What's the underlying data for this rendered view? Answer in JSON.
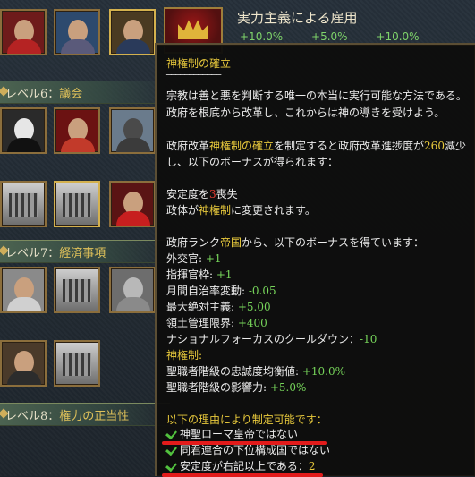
{
  "header": {
    "title": "実力主義による雇用",
    "stats": [
      "+10.0%",
      "+5.0%",
      "+10.0%"
    ]
  },
  "levels": [
    {
      "label_prefix": "レベル6：",
      "label_name": "議会"
    },
    {
      "label_prefix": "レベル7：",
      "label_name": "経済事項"
    },
    {
      "label_prefix": "レベル8：",
      "label_name": "権力の正当性"
    }
  ],
  "tooltip": {
    "title": "神権制の確立",
    "separator": "────────────",
    "desc1": "宗教は善と悪を判断する唯一の本当に実行可能な方法である。",
    "desc2": "政府を根底から改革し、これからは神の導きを受けよう。",
    "enact_a": "政府改革",
    "enact_name": "神権制の確立",
    "enact_b": "を制定すると政府改革進捗度が",
    "enact_cost": "260",
    "enact_c": "減少",
    "enact_line2": "し、以下のボーナスが得られます：",
    "stab_a": "安定度を",
    "stab_val": "3",
    "stab_b": "喪失",
    "gov_a": "政体が",
    "gov_name": "神権制",
    "gov_b": "に変更されます。",
    "rank_a": "政府ランク",
    "rank_name": "帝国",
    "rank_b": "から、以下のボーナスを得ています：",
    "bonuses": [
      {
        "label": "外交官: ",
        "value": "+1"
      },
      {
        "label": "指揮官枠: ",
        "value": "+1"
      },
      {
        "label": "月間自治率変動: ",
        "value": "-0.05"
      },
      {
        "label": "最大絶対主義: ",
        "value": "+5.00"
      },
      {
        "label": "領土管理限界: ",
        "value": "+400"
      },
      {
        "label": "ナショナルフォーカスのクールダウン：",
        "value": "-10"
      }
    ],
    "theocracy_header": "神権制:",
    "theocracy_bonuses": [
      {
        "label": "聖職者階級の忠誠度均衡値: ",
        "value": "+10.0%"
      },
      {
        "label": "聖職者階級の影響力: ",
        "value": "+5.0%"
      }
    ],
    "reasons_header": "以下の理由により制定可能です：",
    "reasons": [
      {
        "label": "神聖ローマ皇帝ではない",
        "value": ""
      },
      {
        "label": "同君連合の下位構成国ではない",
        "value": ""
      },
      {
        "label": "安定度が右記以上である：",
        "value": "2"
      }
    ]
  },
  "colors": {
    "highlight_yellow": "#e8c93c",
    "bonus_green": "#76d45a",
    "penalty_red": "#e23b30",
    "underline_red": "#e21b1b"
  }
}
